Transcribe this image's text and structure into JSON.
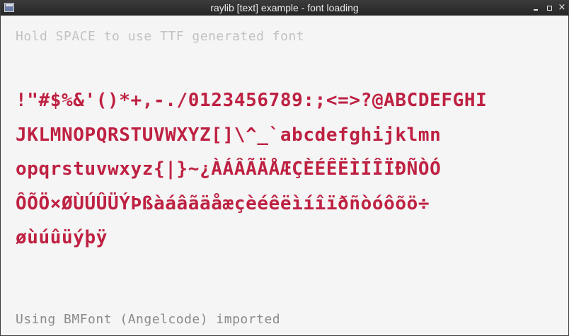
{
  "window": {
    "title": "raylib [text] example - font loading",
    "icon": "window-app-icon",
    "controls": {
      "minimize_icon": "minimize-icon",
      "maximize_icon": "maximize-icon",
      "close_icon": "close-icon",
      "close_glyph": "×"
    }
  },
  "canvas": {
    "hint_text": "Hold SPACE to use TTF generated font",
    "glyph_lines": [
      "!\"#$%&'()*+,-./0123456789:;<=>?@ABCDEFGHI",
      "JKLMNOPQRSTUVWXYZ[]\\^_`abcdefghijklmn",
      "opqrstuvwxyz{|}~¿ÀÁÂÃÄÅÆÇÈÉÊËÌÍÎÏÐÑÒÓ",
      "ÔÕÖ×ØÙÚÛÜÝÞßàáâãäåæçèéêëìíîïðñòóôõö÷",
      "øùúûüýþÿ"
    ],
    "status_text": "Using BMFont (Angelcode) imported"
  },
  "colors": {
    "glyph_text": "#be2142",
    "hint_text": "#c2c2c2",
    "status_text": "#8a8a8a",
    "background": "#f5f5f5",
    "titlebar": "#2e2e2e"
  }
}
